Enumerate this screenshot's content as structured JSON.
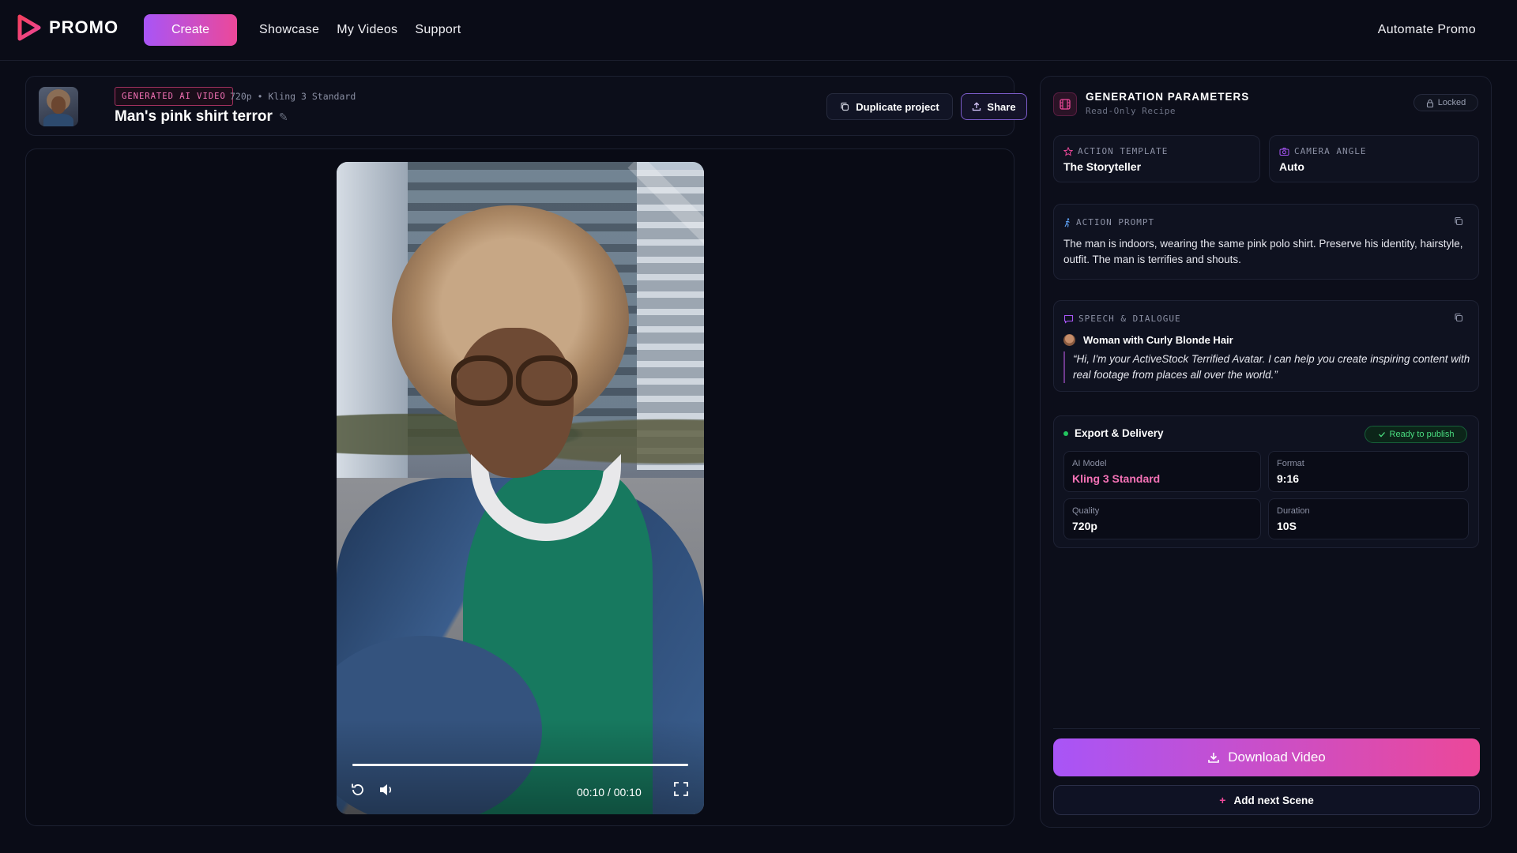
{
  "header": {
    "logo_text": "PROMO",
    "create_label": "Create",
    "nav": [
      "Showcase",
      "My Videos",
      "Support"
    ],
    "automate_label": "Automate Promo"
  },
  "project": {
    "badge": "GENERATED AI VIDEO",
    "meta": "720p • Kling 3 Standard",
    "title": "Man's pink shirt terror",
    "duplicate_label": "Duplicate project",
    "share_label": "Share"
  },
  "player": {
    "time": "00:10 / 00:10",
    "progress": 1.0
  },
  "params": {
    "title": "GENERATION PARAMETERS",
    "subtitle": "Read-Only Recipe",
    "locked_label": "Locked",
    "action_template": {
      "label": "ACTION TEMPLATE",
      "value": "The Storyteller"
    },
    "camera_angle": {
      "label": "CAMERA ANGLE",
      "value": "Auto"
    },
    "action_prompt": {
      "label": "ACTION PROMPT",
      "text": "The man is indoors, wearing the same pink polo shirt. Preserve his identity, hairstyle, outfit. The man is terrifies and shouts."
    },
    "speech": {
      "label": "SPEECH & DIALOGUE",
      "speaker": "Woman with Curly Blonde Hair",
      "quote": "“Hi, I'm your ActiveStock Terrified Avatar. I can help you create inspiring content with real footage from places all over the world.”"
    },
    "export": {
      "title": "Export & Delivery",
      "status": "Ready to publish",
      "ai_model": {
        "label": "AI Model",
        "value": "Kling 3 Standard"
      },
      "format": {
        "label": "Format",
        "value": "9:16"
      },
      "quality": {
        "label": "Quality",
        "value": "720p"
      },
      "duration": {
        "label": "Duration",
        "value": "10S"
      }
    }
  },
  "actions": {
    "download_label": "Download Video",
    "next_scene_label": "Add next Scene"
  },
  "colors": {
    "accent_start": "#a855f7",
    "accent_end": "#ec4899",
    "background": "#0a0c17",
    "ready_green": "#4ade80"
  }
}
